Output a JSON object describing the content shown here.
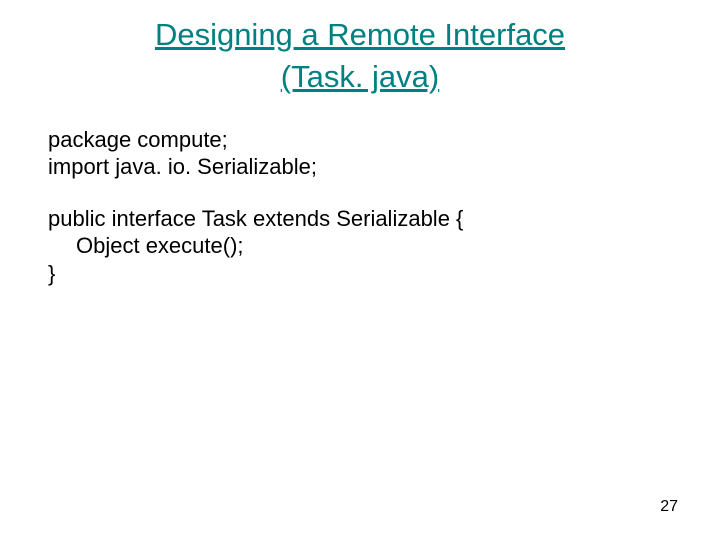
{
  "title": {
    "line1": "Designing a Remote Interface",
    "line2": "(Task. java)"
  },
  "code": {
    "l1": "package compute;",
    "l2": "import java. io. Serializable;",
    "l3": "public interface Task extends Serializable {",
    "l4": "Object execute();",
    "l5": "}"
  },
  "page_number": "27"
}
